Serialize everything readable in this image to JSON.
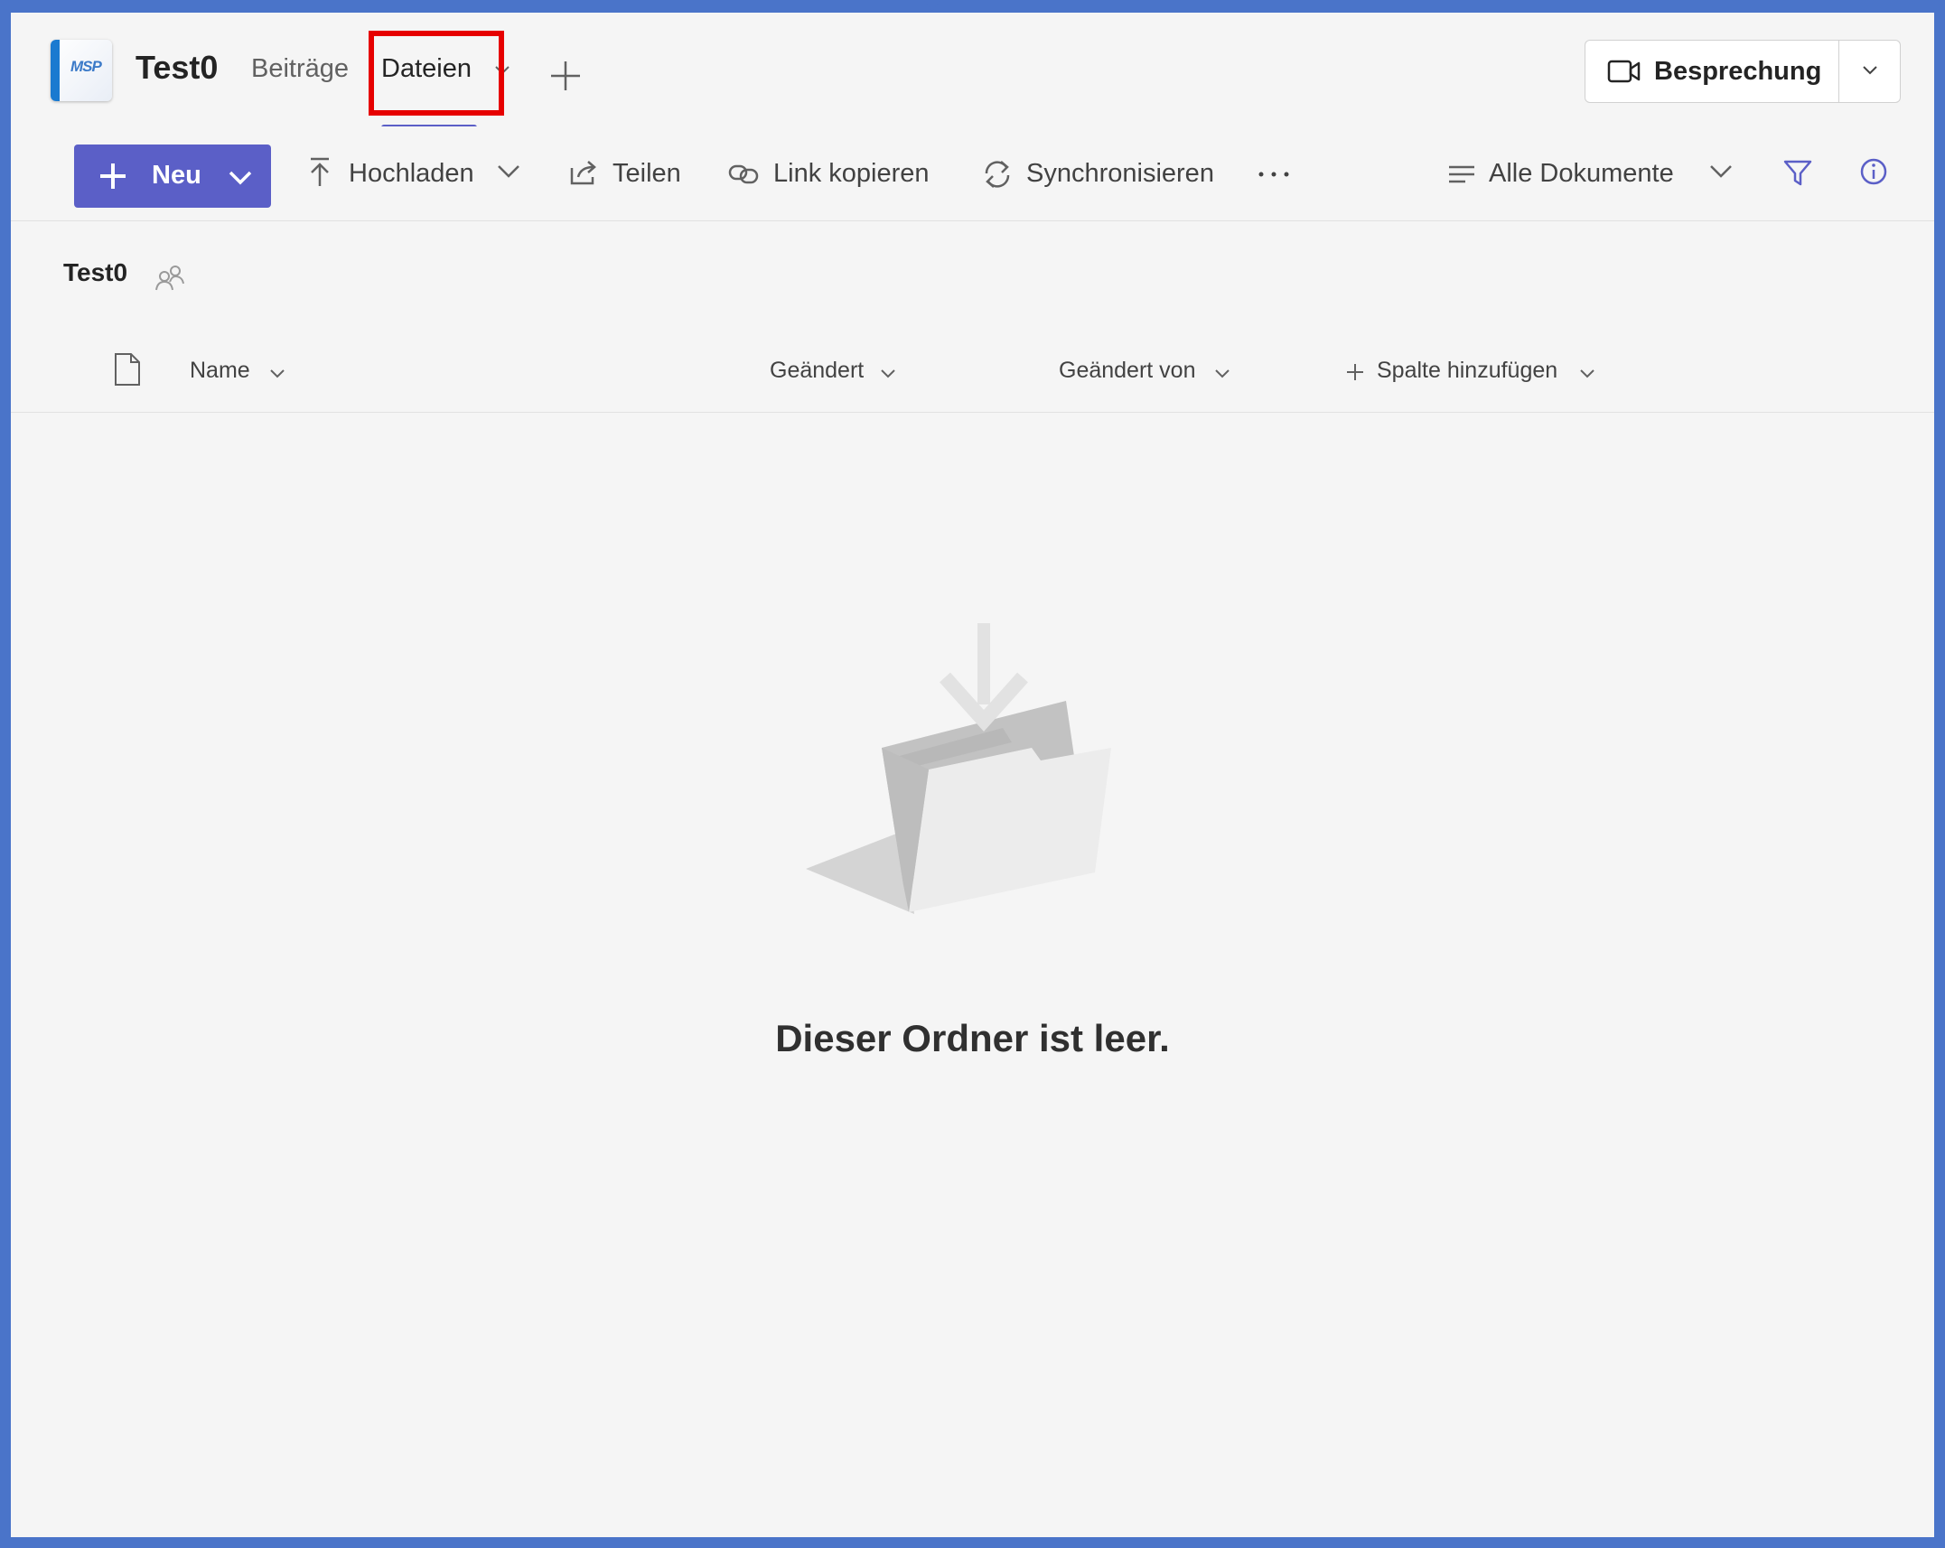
{
  "team": {
    "name": "Test0",
    "logo_text": "MSP"
  },
  "tabs": [
    {
      "label": "Beiträge"
    },
    {
      "label": "Dateien"
    }
  ],
  "meeting": {
    "label": "Besprechung"
  },
  "command_bar": {
    "new_label": "Neu",
    "upload_label": "Hochladen",
    "share_label": "Teilen",
    "copy_link_label": "Link kopieren",
    "sync_label": "Synchronisieren",
    "more_label": "···",
    "view_label": "Alle Dokumente"
  },
  "breadcrumb": {
    "current": "Test0"
  },
  "columns": {
    "name": "Name",
    "modified": "Geändert",
    "modified_by": "Geändert von",
    "add_column": "Spalte hinzufügen"
  },
  "empty_state": {
    "message": "Dieser Ordner ist leer."
  },
  "colors": {
    "accent": "#5b5fc7",
    "highlight": "#e60000",
    "frame": "#4a74c9"
  }
}
